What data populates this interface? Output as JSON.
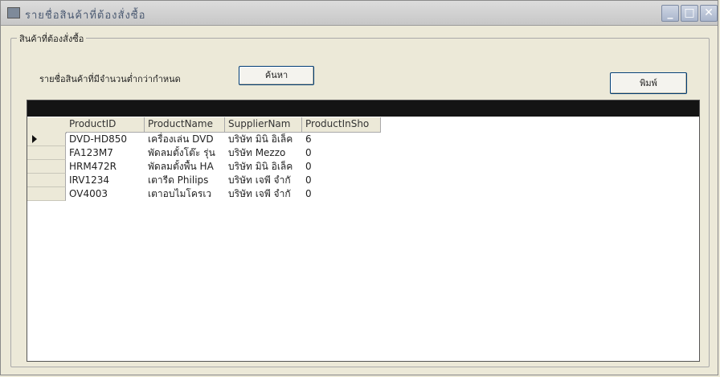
{
  "window": {
    "title": "รายชื่อสินค้าที่ต้องสั่งซื้อ",
    "minimize_glyph": "_",
    "maximize_glyph": "□",
    "close_glyph": "✕"
  },
  "group": {
    "label": "สินค้าที่ต้องสั่งซื้อ",
    "caption": "รายชื่อสินค้าที่มีจำนวนต่ำกว่ากำหนด",
    "search_button": "ค้นหา",
    "print_button": "พิมพ์"
  },
  "grid": {
    "columns": [
      "ProductID",
      "ProductName",
      "SupplierNam",
      "ProductInSho"
    ],
    "selected_row": 0,
    "rows": [
      [
        "DVD-HD850",
        "เครื่องเล่น DVD",
        "บริษัท มินิ อิเล็ค",
        "6"
      ],
      [
        "FA123M7",
        "พัดลมตั้งโต๊ะ รุ่น",
        "บริษัท Mezzo",
        "0"
      ],
      [
        "HRM472R",
        "พัดลมตั้งพื้น HA",
        "บริษัท มินิ อิเล็ค",
        "0"
      ],
      [
        "IRV1234",
        "เตารีด Philips",
        "บริษัท เจพี จำกั",
        "0"
      ],
      [
        "OV4003",
        "เตาอบไมโครเว",
        "บริษัท เจพี จำกั",
        "0"
      ]
    ]
  }
}
